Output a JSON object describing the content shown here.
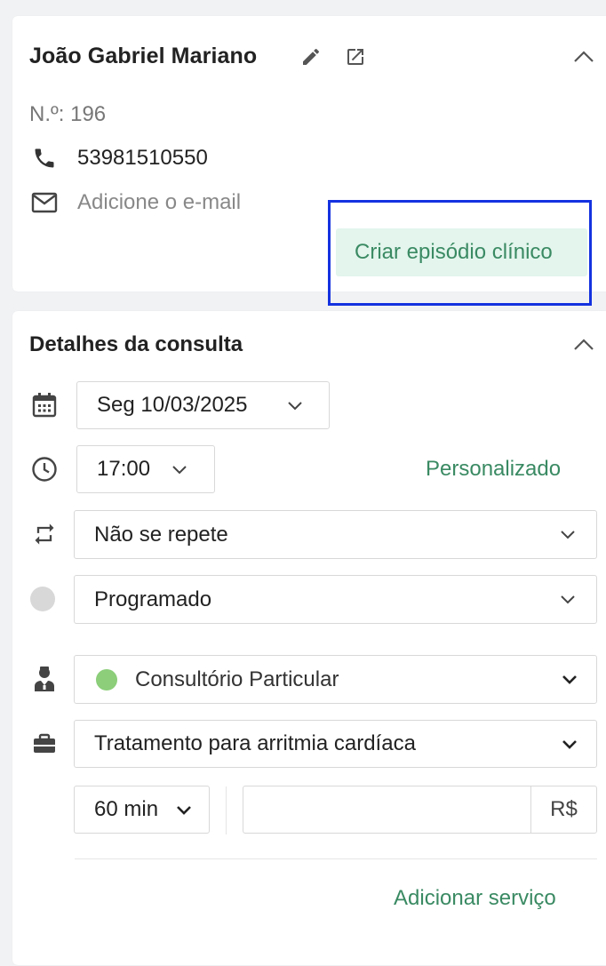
{
  "patient": {
    "name": "João Gabriel Mariano",
    "number": "N.º: 196",
    "phone": "53981510550",
    "email_placeholder": "Adicione o e-mail",
    "create_episode_label": "Criar episódio clínico"
  },
  "details": {
    "title": "Detalhes da consulta",
    "date": "Seg 10/03/2025",
    "time": "17:00",
    "custom_label": "Personalizado",
    "repeat": "Não se repete",
    "status": "Programado",
    "office": "Consultório Particular",
    "service": "Tratamento para arritmia cardíaca",
    "duration": "60 min",
    "price_value": "",
    "currency": "R$",
    "add_service_label": "Adicionar serviço"
  },
  "colors": {
    "accent_green": "#3a8a63",
    "episode_bg": "#e3f5ed",
    "office_dot": "#8cce7a",
    "status_dot": "#d8d8d8",
    "highlight": "#1432e0"
  },
  "icons": [
    "edit-icon",
    "external-link-icon",
    "chevron-up-icon",
    "phone-icon",
    "mail-icon",
    "calendar-icon",
    "clock-icon",
    "repeat-icon",
    "doctor-icon",
    "briefcase-icon",
    "chevron-down-icon"
  ]
}
